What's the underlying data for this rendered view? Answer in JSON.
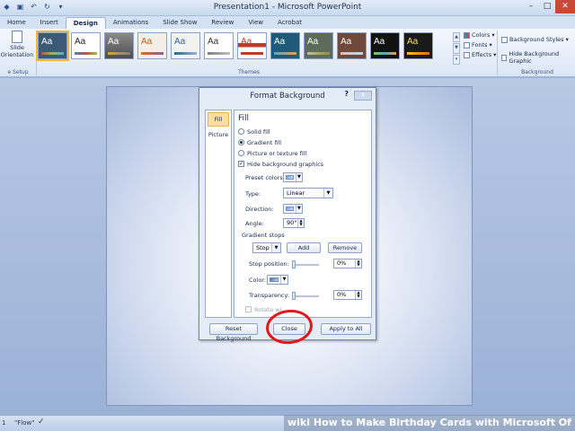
{
  "window": {
    "title": "Presentation1 - Microsoft PowerPoint",
    "buttons": [
      "–",
      "□",
      "✕"
    ]
  },
  "qat": [
    "save-icon",
    "undo-icon",
    "redo-icon",
    "customize-icon"
  ],
  "tabs": [
    "Home",
    "Insert",
    "Design",
    "Animations",
    "Slide Show",
    "Review",
    "View",
    "Acrobat"
  ],
  "active_tab": "Design",
  "ribbon": {
    "slide_orientation": "Slide Orientation",
    "page_setup_label": "e Setup",
    "themes_label": "Themes",
    "theme_aa": [
      "Aa",
      "Aa",
      "Aa",
      "Aa",
      "Aa",
      "Aa",
      "Aa",
      "Aa",
      "Aa",
      "Aa",
      "Aa",
      "Aa"
    ],
    "colors": "Colors",
    "fonts": "Fonts",
    "effects": "Effects",
    "background_styles": "Background Styles",
    "hide_bg_graphics": "Hide Background Graphic",
    "background_label": "Background"
  },
  "dialog": {
    "title": "Format Background",
    "help": "?",
    "close_x": "X",
    "nav": [
      "Fill",
      "Picture"
    ],
    "section": "Fill",
    "solid_fill": "Solid fill",
    "gradient_fill": "Gradient fill",
    "picture_fill": "Picture or texture fill",
    "hide_bg": "Hide background graphics",
    "preset_colors": "Preset colors:",
    "type_label": "Type:",
    "type_value": "Linear",
    "direction_label": "Direction:",
    "angle_label": "Angle:",
    "angle_value": "90°",
    "gradient_stops": "Gradient stops",
    "stop_value": "Stop 1",
    "add": "Add",
    "remove": "Remove",
    "stop_position": "Stop position:",
    "stop_position_value": "0%",
    "color_label": "Color:",
    "transparency_label": "Transparency:",
    "transparency_value": "0%",
    "rotate": "Rotate wi",
    "reset": "Reset Background",
    "close": "Close",
    "apply_all": "Apply to All"
  },
  "status": {
    "slide": "1",
    "theme": "\"Flow\""
  },
  "watermark": {
    "w1": "wiki",
    "w2": "How to Make Birthday Cards with Microsoft Of"
  },
  "colors": {
    "accent_circle": "#e2161d",
    "selected_theme": "#f2b63a"
  }
}
